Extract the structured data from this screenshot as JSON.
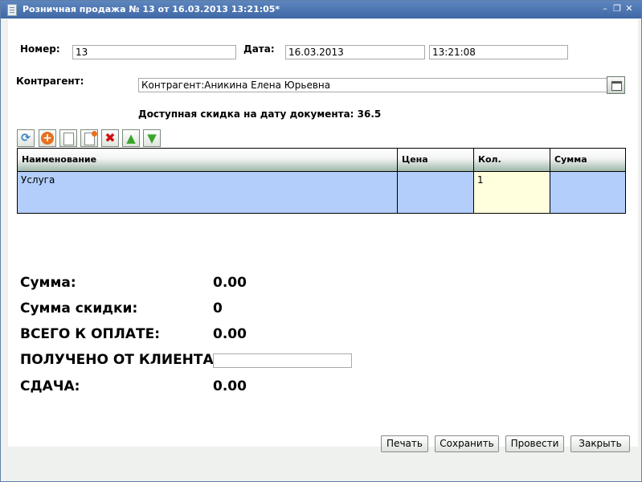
{
  "window": {
    "title": "Розничная продажа № 13 от 16.03.2013 13:21:05*"
  },
  "fields": {
    "number_label": "Номер:",
    "number_value": "13",
    "date_label": "Дата:",
    "date_value": "16.03.2013",
    "time_value": "13:21:08",
    "counterparty_label": "Контрагент:",
    "counterparty_value": "Контрагент:Аникина Елена Юрьевна"
  },
  "discount_info": "Доступная скидка на дату документа: 36.5",
  "toolbar": {
    "icons": [
      "refresh-icon",
      "add-icon",
      "new-document-icon",
      "copy-document-icon",
      "delete-icon",
      "move-up-icon",
      "move-down-icon"
    ]
  },
  "grid": {
    "columns": [
      "Наименование",
      "Цена",
      "Кол.",
      "Сумма"
    ],
    "rows": [
      {
        "name": "Услуга",
        "price": "",
        "qty": "1",
        "sum": ""
      }
    ]
  },
  "totals": {
    "sum_label": "Сумма:",
    "sum_value": "0.00",
    "discount_label": "Сумма скидки:",
    "discount_value": "0",
    "total_label": "ВСЕГО К ОПЛАТЕ:",
    "total_value": "0.00",
    "received_label": "ПОЛУЧЕНО ОТ КЛИЕНТА:",
    "received_value": "",
    "change_label": "СДАЧА:",
    "change_value": "0.00"
  },
  "buttons": {
    "print": "Печать",
    "save": "Сохранить",
    "post": "Провести",
    "close": "Закрыть"
  }
}
